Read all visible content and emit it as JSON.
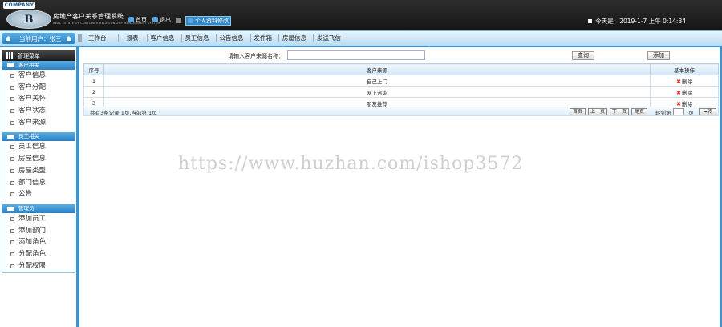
{
  "header": {
    "company_tab": "COMPANY",
    "logo_text": "B",
    "system_title": "房地产客户关系管理系统",
    "system_subtitle": "REAL ESTATE OF CUSTOMER RELATIONSHIP MANAGEMENT SYSTEM",
    "home_label": "首页",
    "logout_label": "退出",
    "profile_label": "个人资料修改",
    "date_text": "今天是：2019-1-7 上午 0:14:34"
  },
  "nav": {
    "current_user": "当前用户：张三",
    "links": [
      "工作台",
      "报表",
      "客户信息",
      "员工信息",
      "公告信息",
      "发件箱",
      "房屋信息",
      "发送飞信"
    ]
  },
  "sidebar": {
    "title": "管理菜单",
    "groups": [
      {
        "title": "客户相关",
        "items": [
          "客户信息",
          "客户分配",
          "客户关怀",
          "客户状态",
          "客户来源"
        ]
      },
      {
        "title": "员工相关",
        "items": [
          "员工信息",
          "房屋信息",
          "房屋类型",
          "部门信息",
          "公告"
        ]
      },
      {
        "title": "管理员",
        "items": [
          "添加员工",
          "添加部门",
          "添加角色",
          "分配角色",
          "分配权限"
        ]
      }
    ]
  },
  "search": {
    "label": "请输入客户来源名称：",
    "value": "",
    "query_label": "查询",
    "add_label": "添加"
  },
  "table": {
    "headers": [
      "序号",
      "客户来源",
      "基本操作"
    ],
    "rows": [
      {
        "no": "1",
        "source": "自己上门",
        "action": "删除"
      },
      {
        "no": "2",
        "source": "网上咨询",
        "action": "删除"
      },
      {
        "no": "3",
        "source": "朋友推荐",
        "action": "删除"
      }
    ]
  },
  "pager": {
    "summary": "共有3条记录,1页,当前第 1页",
    "first": "首页",
    "prev": "上一页",
    "next": "下一页",
    "last": "尾页",
    "goto_label": "转到第",
    "page_unit": "页",
    "go_label": "➡转",
    "goto_value": ""
  },
  "watermark": "https://www.huzhan.com/ishop3572",
  "colors": {
    "accent": "#3d93cf",
    "header_bg": "#1e1e1e",
    "delete_icon": "#e22222"
  }
}
